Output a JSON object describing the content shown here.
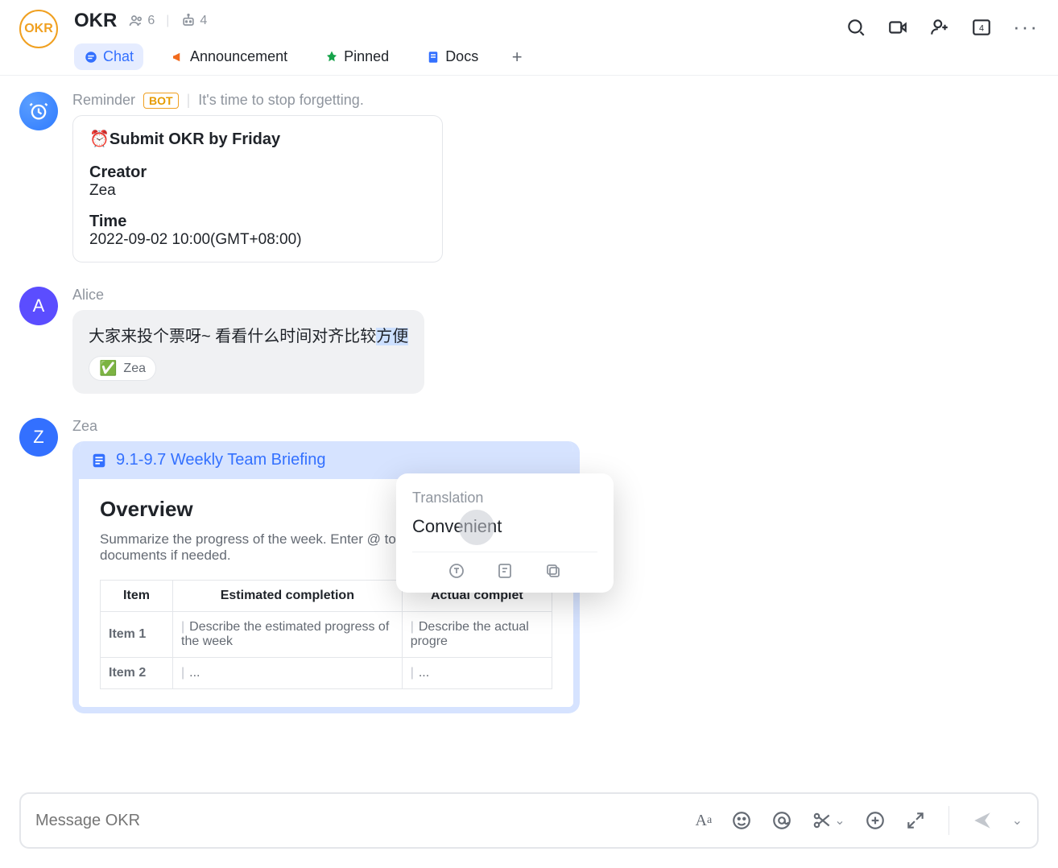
{
  "group": {
    "avatar_label": "OKR",
    "title": "OKR",
    "members": "6",
    "bots": "4"
  },
  "tabs": {
    "chat": "Chat",
    "announcement": "Announcement",
    "pinned": "Pinned",
    "docs": "Docs"
  },
  "reminder": {
    "sender": "Reminder",
    "bot_badge": "BOT",
    "subtitle": "It's time to stop forgetting.",
    "card": {
      "title": "⏰Submit OKR by Friday",
      "creator_label": "Creator",
      "creator_value": "Zea",
      "time_label": "Time",
      "time_value": "2022-09-02 10:00(GMT+08:00)"
    }
  },
  "alice": {
    "avatar_letter": "A",
    "name": "Alice",
    "text_plain": "大家来投个票呀~ 看看什么时间对齐比较",
    "text_selected": "方便",
    "reaction_name": "Zea"
  },
  "translation": {
    "title": "Translation",
    "result": "Convenient"
  },
  "zea": {
    "avatar_letter": "Z",
    "name": "Zea",
    "doc_title": "9.1-9.7 Weekly Team Briefing",
    "overview_h": "Overview",
    "overview_p": "Summarize the progress of the week. Enter @ to insert relevant documents if needed.",
    "table": {
      "h_item": "Item",
      "h_est": "Estimated completion",
      "h_act": "Actual complet",
      "rows": [
        {
          "item": "Item 1",
          "est": "Describe the estimated progress of the week",
          "act": "Describe the actual progre"
        },
        {
          "item": "Item 2",
          "est": "...",
          "act": "..."
        }
      ]
    }
  },
  "composer": {
    "placeholder": "Message OKR"
  }
}
